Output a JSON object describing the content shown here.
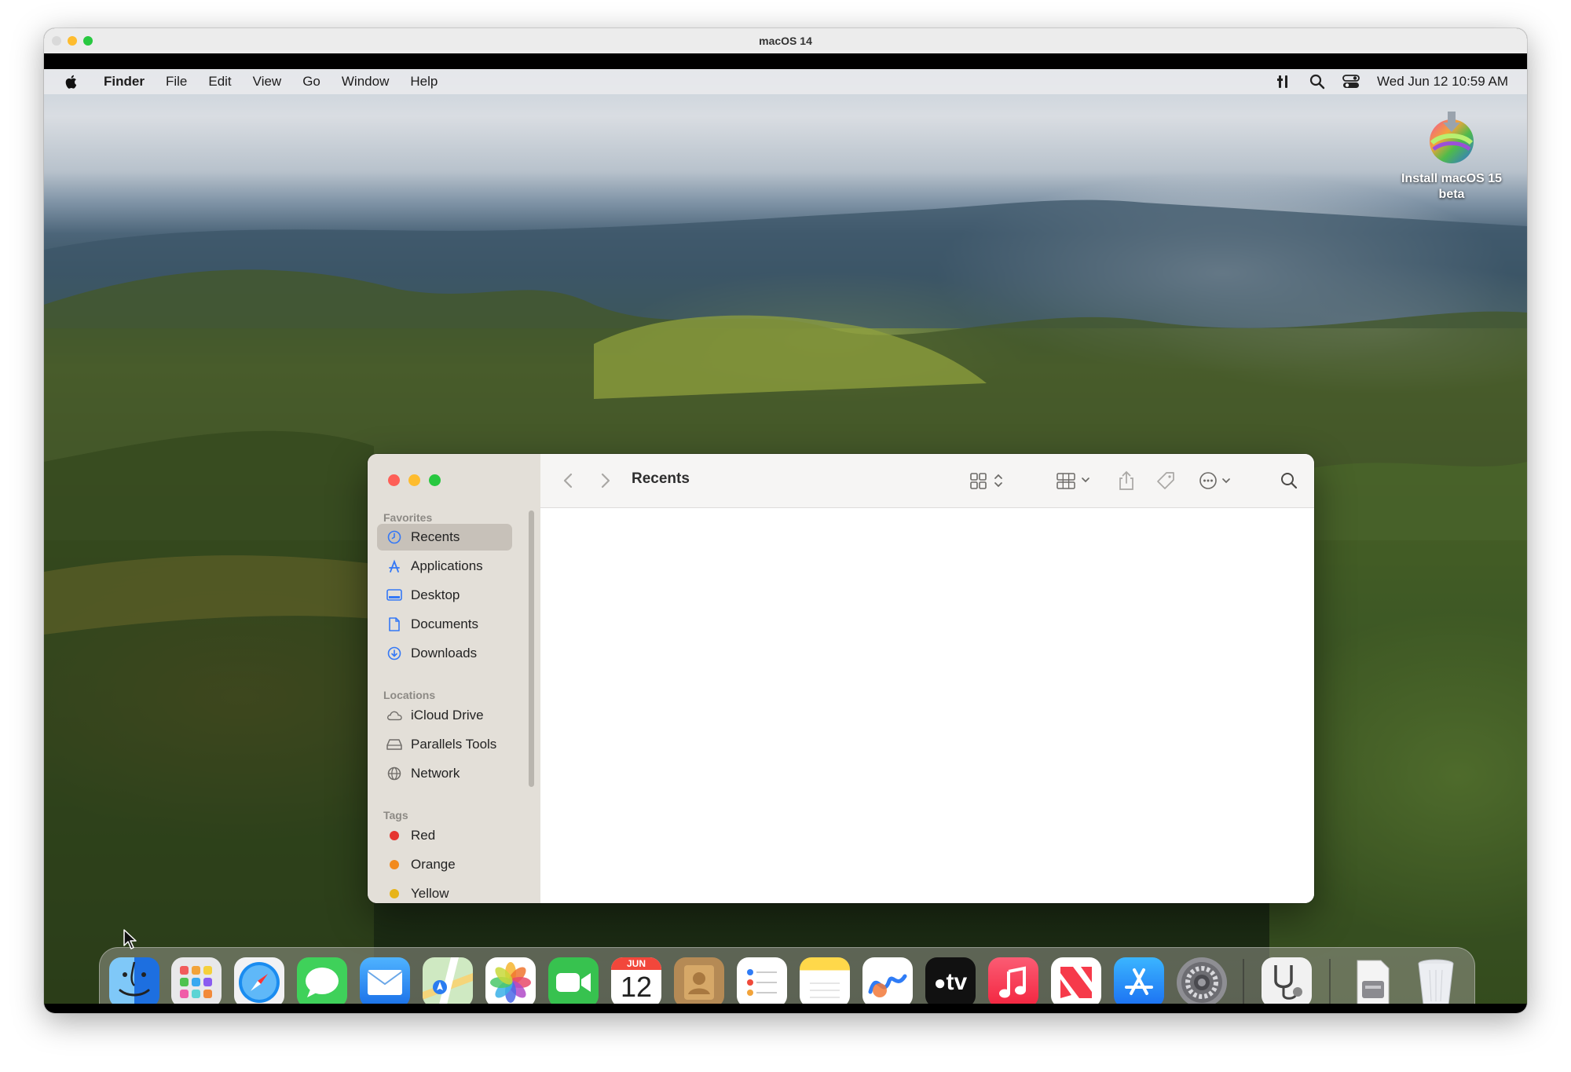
{
  "vm": {
    "title": "macOS 14"
  },
  "menubar": {
    "app": "Finder",
    "items": [
      "File",
      "Edit",
      "View",
      "Go",
      "Window",
      "Help"
    ],
    "clock": "Wed Jun 12  10:59 AM",
    "icons": [
      "apple-icon",
      "parallels-tools-icon",
      "spotlight-icon",
      "control-center-icon"
    ]
  },
  "desktop_icon": {
    "label_line1": "Install macOS 15",
    "label_line2": "beta"
  },
  "finder": {
    "title": "Recents",
    "sidebar": {
      "favorites_label": "Favorites",
      "favorites": [
        "Recents",
        "Applications",
        "Desktop",
        "Documents",
        "Downloads"
      ],
      "locations_label": "Locations",
      "locations": [
        "iCloud Drive",
        "Parallels Tools",
        "Network"
      ],
      "tags_label": "Tags",
      "tags": [
        {
          "name": "Red",
          "color": "#e5352f"
        },
        {
          "name": "Orange",
          "color": "#f28a1d"
        },
        {
          "name": "Yellow",
          "color": "#e7b418"
        }
      ]
    },
    "toolbar_icons": [
      "back-icon",
      "forward-icon",
      "view-options-icon",
      "group-icon",
      "share-icon",
      "tag-icon",
      "more-icon",
      "search-icon"
    ]
  },
  "dock": {
    "apps": [
      "Finder",
      "Launchpad",
      "Safari",
      "Messages",
      "Mail",
      "Maps",
      "Photos",
      "FaceTime",
      "Calendar",
      "Contacts",
      "Reminders",
      "Notes",
      "Freeform",
      "TV",
      "Music",
      "News",
      "App Store",
      "System Settings",
      "Parallels Tools",
      "Installer",
      "Trash"
    ],
    "calendar_month": "JUN",
    "calendar_day": "12",
    "tv_label": "tv"
  },
  "colors": {
    "accent": "#3478f6",
    "close": "#fe5f57",
    "minimize": "#febc2e",
    "zoom": "#28c840"
  }
}
